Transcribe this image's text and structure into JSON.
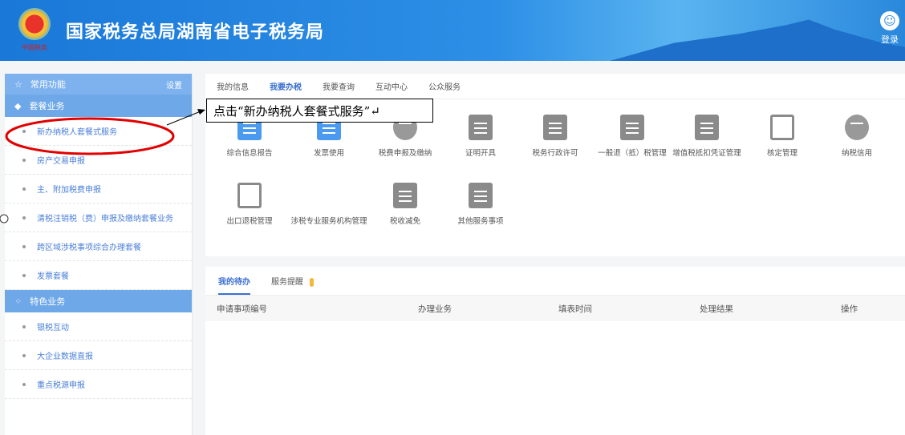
{
  "header": {
    "title": "国家税务总局湖南省电子税务局",
    "logo_text": "中国税务",
    "login": "登录"
  },
  "sidebar": {
    "common": {
      "label": "常用功能",
      "settings": "设置"
    },
    "package": {
      "label": "套餐业务",
      "items": [
        "新办纳税人套餐式服务",
        "房产交易申报",
        "主、附加税费申报",
        "清税注销税（费）申报及缴纳套餐业务",
        "跨区域涉税事项综合办理套餐",
        "发票套餐"
      ]
    },
    "special": {
      "label": "特色业务",
      "items": [
        "银税互动",
        "大企业数据直报",
        "重点税源申报"
      ]
    }
  },
  "main": {
    "tabs": [
      "我的信息",
      "我要办税",
      "我要查询",
      "互动中心",
      "公众服务"
    ],
    "active_tab": "我要办税",
    "services": [
      "综合信息报告",
      "发票使用",
      "税费申报及缴纳",
      "证明开具",
      "税务行政许可",
      "一般退（抵）税管理",
      "增值税抵扣凭证管理",
      "核定管理",
      "纳税信用",
      "出口退税管理",
      "涉税专业服务机构管理",
      "税收减免",
      "其他服务事项"
    ]
  },
  "todo": {
    "tabs": [
      "我的待办",
      "服务提醒"
    ],
    "columns": [
      "申请事项编号",
      "办理业务",
      "填表时间",
      "处理结果",
      "操作"
    ]
  },
  "annotation": {
    "text": "点击“新办纳税人套餐式服务”↵",
    "mark": "↵"
  },
  "colors": {
    "header": "#2a88dc",
    "sidebar_head": "#6fa8e8",
    "link": "#4a7fd8",
    "highlight": "#e00000"
  }
}
